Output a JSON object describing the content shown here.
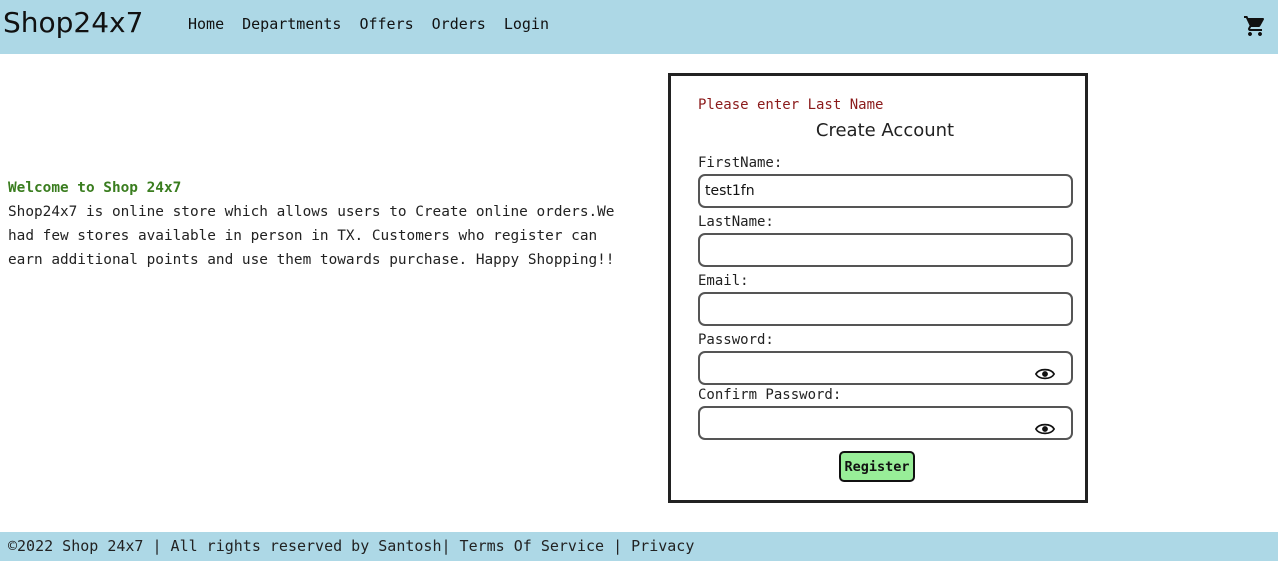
{
  "header": {
    "brand": "Shop24x7",
    "nav": [
      "Home",
      "Departments",
      "Offers",
      "Orders",
      "Login"
    ],
    "cart_icon": "shopping-cart-icon"
  },
  "welcome": {
    "title": "Welcome to Shop 24x7",
    "text": "Shop24x7 is online store which allows users to Create online orders.We had few stores available in person in TX. Customers who register can earn additional points and use them towards purchase. Happy Shopping!!"
  },
  "form": {
    "error": "Please enter Last Name",
    "title": "Create Account",
    "first_name_label": "FirstName:",
    "first_name_value": "test1fn",
    "last_name_label": "LastName:",
    "last_name_value": "",
    "email_label": "Email:",
    "email_value": "",
    "password_label": "Password:",
    "password_value": "",
    "confirm_password_label": "Confirm Password:",
    "confirm_password_value": "",
    "register_label": "Register"
  },
  "footer": {
    "copyright": "©2022 Shop 24x7 | All rights reserved by Santosh",
    "separator1": "| ",
    "terms": "Terms Of Service",
    "separator2": " | ",
    "privacy": "Privacy"
  },
  "colors": {
    "header_bg": "#add8e6",
    "welcome_title": "#3a7d1f",
    "error_text": "#8b1a1a",
    "register_bg": "#98ee98"
  }
}
